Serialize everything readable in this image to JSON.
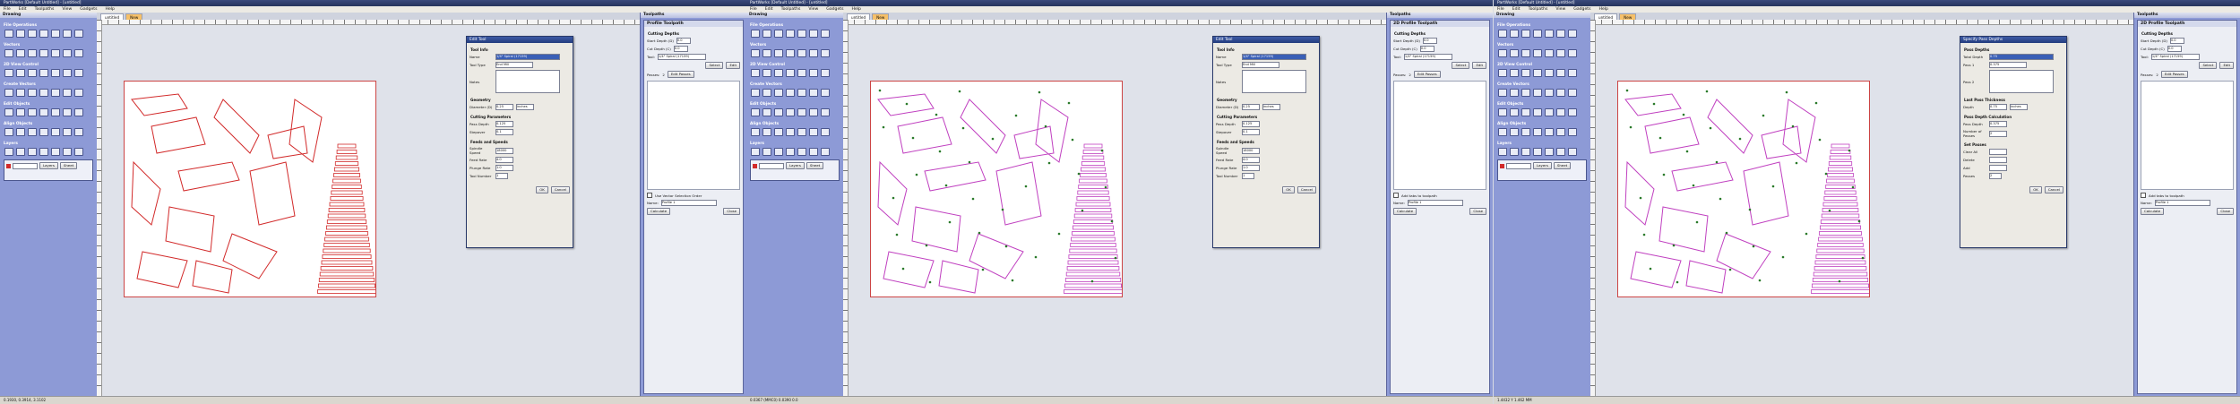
{
  "colors": {
    "accent": "#2a3a6a",
    "pane": "#8d9ad6",
    "vector": "#d22a2a",
    "toolpath": "#c040c0"
  },
  "menu": [
    "File",
    "Edit",
    "Toolpaths",
    "View",
    "Gadgets",
    "Help"
  ],
  "panels": [
    {
      "title": "PartWorks [Default Untitled] - [untitled]",
      "left_header": "Drawing",
      "left_sections": [
        "File Operations",
        "Vectors",
        "2D View Control",
        "Create Vectors",
        "Edit Objects",
        "Align Objects",
        "Layers"
      ],
      "tab_labels": [
        "untitled",
        "New"
      ],
      "right_header": "Toolpaths",
      "right_title": "Profile Toolpath",
      "cutting_depths_label": "Cutting Depths",
      "start_depth_label": "Start Depth (D)",
      "start_depth": "0.0",
      "cut_depth_label": "Cut Depth (C)",
      "cut_depth": "0.0",
      "tool_label": "Tool:",
      "tool_value": "1/4\" Spiral (17159)",
      "select_label": "Select",
      "edit_label": "Edit",
      "passes_label": "Passes:",
      "passes_value": "2",
      "edit_passes_label": "Edit Passes",
      "order_label": "Use Vector Selection Order",
      "name_label": "Name:",
      "name_value": "Profile 1",
      "calculate_label": "Calculate",
      "close_label": "Close",
      "dialog": {
        "title": "Edit Tool",
        "tool_info": "Tool Info",
        "name_label": "Name",
        "name_value": "1/4\" Spiral (17159)",
        "tool_type_label": "Tool Type",
        "tool_type": "End Mill",
        "notes_label": "Notes",
        "geometry_label": "Geometry",
        "diameter_label": "Diameter (D)",
        "diameter_value": "0.25",
        "units": "inches",
        "cutting_params_label": "Cutting Parameters",
        "pass_depth_label": "Pass Depth",
        "pass_depth": "0.125",
        "stepover_label": "Stepover",
        "stepover": "0.1",
        "feeds_label": "Feeds and Speeds",
        "spindle_label": "Spindle Speed",
        "spindle": "18000",
        "feed_rate_label": "Feed Rate",
        "feed_rate": "4.0",
        "plunge_label": "Plunge Rate",
        "plunge": "1.0",
        "tool_number_label": "Tool Number",
        "tool_number": "1",
        "ok": "OK",
        "cancel": "Cancel"
      },
      "status": "0.1930, 0.3914, 3.1102"
    },
    {
      "title": "PartWorks [Default Untitled] - [untitled]",
      "left_header": "Drawing",
      "left_sections": [
        "File Operations",
        "Vectors",
        "2D View Control",
        "Create Vectors",
        "Edit Objects",
        "Align Objects",
        "Layers"
      ],
      "tab_labels": [
        "untitled",
        "New"
      ],
      "right_header": "Toolpaths",
      "right_title": "2D Profile Toolpath",
      "cutting_depths_label": "Cutting Depths",
      "start_depth_label": "Start Depth (D)",
      "start_depth": "0.0",
      "cut_depth_label": "Cut Depth (C)",
      "cut_depth": "0.0",
      "tool_label": "Tool:",
      "tool_value": "1/4\" Spiral (17159)",
      "select_label": "Select",
      "edit_label": "Edit",
      "passes_label": "Passes:",
      "passes_value": "2",
      "edit_passes_label": "Edit Passes",
      "order_label": "Add tabs to toolpath",
      "name_label": "Name:",
      "name_value": "Profile 1",
      "calculate_label": "Calculate",
      "close_label": "Close",
      "dialog": {
        "title": "Edit Tool",
        "tool_info": "Tool Info",
        "name_label": "Name",
        "name_value": "1/4\" Spiral (17159)",
        "tool_type_label": "Tool Type",
        "tool_type": "End Mill",
        "notes_label": "Notes",
        "geometry_label": "Geometry",
        "diameter_label": "Diameter (D)",
        "diameter_value": "0.25",
        "units": "inches",
        "cutting_params_label": "Cutting Parameters",
        "pass_depth_label": "Pass Depth",
        "pass_depth": "0.125",
        "stepover_label": "Stepover",
        "stepover": "0.1",
        "feeds_label": "Feeds and Speeds",
        "spindle_label": "Spindle Speed",
        "spindle": "18000",
        "feed_rate_label": "Feed Rate",
        "feed_rate": "4.0",
        "plunge_label": "Plunge Rate",
        "plunge": "1.0",
        "tool_number_label": "Tool Number",
        "tool_number": "1",
        "ok": "OK",
        "cancel": "Cancel"
      },
      "status": "0.0367 (MMC0) 0.0390 0.0"
    },
    {
      "title": "PartWorks [Default Untitled] - [untitled]",
      "left_header": "Drawing",
      "left_sections": [
        "File Operations",
        "Vectors",
        "2D View Control",
        "Create Vectors",
        "Edit Objects",
        "Align Objects",
        "Layers"
      ],
      "tab_labels": [
        "untitled",
        "New"
      ],
      "right_header": "Toolpaths",
      "right_title": "2D Profile Toolpath",
      "cutting_depths_label": "Cutting Depths",
      "start_depth_label": "Start Depth (D)",
      "start_depth": "0.0",
      "cut_depth_label": "Cut Depth (C)",
      "cut_depth": "0.0",
      "tool_label": "Tool:",
      "tool_value": "1/4\" Spiral (17159)",
      "select_label": "Select",
      "edit_label": "Edit",
      "passes_label": "Passes:",
      "passes_value": "2",
      "edit_passes_label": "Edit Passes",
      "order_label": "Add tabs to toolpath",
      "name_label": "Name:",
      "name_value": "Profile 1",
      "calculate_label": "Calculate",
      "close_label": "Close",
      "dialog": {
        "title": "Specify Pass Depths",
        "tool_info": "Pass Depths",
        "name_label": "Total Depth",
        "name_value": "0.75",
        "tool_type_label": "Pass 1",
        "tool_type": "0.375",
        "notes_label": "Pass 2",
        "geometry_label": "Last Pass Thickness",
        "diameter_label": "Depth",
        "diameter_value": "0.75",
        "units": "inches",
        "cutting_params_label": "Pass Depth Calculation",
        "pass_depth_label": "Pass Depth",
        "pass_depth": "0.375",
        "stepover_label": "Number of Passes",
        "stepover": "2",
        "feeds_label": "Set Passes",
        "spindle_label": "Clear All",
        "spindle": "",
        "feed_rate_label": "Delete",
        "feed_rate": "",
        "plunge_label": "Add",
        "plunge": "",
        "tool_number_label": "Passes",
        "tool_number": "2",
        "ok": "OK",
        "cancel": "Cancel"
      },
      "status": "1.4432 Y 1.462 MM"
    }
  ],
  "layers_label": "Layers",
  "sheet_label": "Sheet"
}
